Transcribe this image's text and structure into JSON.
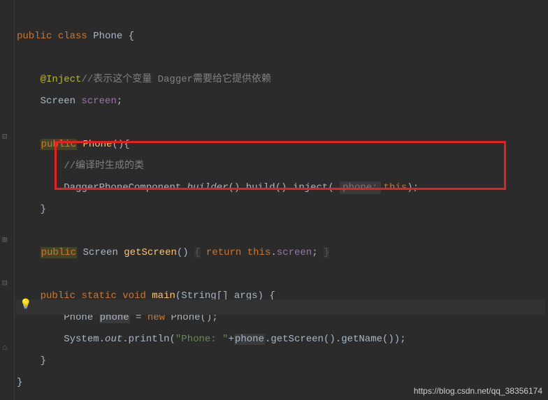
{
  "line1": {
    "public": "public",
    "class": "class",
    "name": "Phone",
    "brace": "{"
  },
  "line3": {
    "anno": "@Inject",
    "comment": "//表示这个变量 Dagger需要给它提供依赖"
  },
  "line4": {
    "type": "Screen",
    "field": "screen",
    "semi": ";"
  },
  "line6": {
    "public": "public",
    "ctor": "Phone",
    "paren": "(){"
  },
  "line7": {
    "comment": "//编译时生成的类"
  },
  "line8": {
    "cls": "DaggerPhoneComponent",
    "dot1": ".",
    "builder": "builder",
    "call1": "().",
    "build": "build",
    "call2": "().",
    "inject": "inject",
    "open": "(",
    "hint": "phone:",
    "this": "this",
    "close": ");"
  },
  "line9": {
    "brace": "}"
  },
  "line11": {
    "public": "public",
    "type": "Screen",
    "name": "getScreen",
    "paren": "()",
    "open": "{",
    "return": "return",
    "this": "this",
    "dot": ".",
    "field": "screen",
    "semi": ";",
    "close": "}"
  },
  "line13": {
    "public": "public",
    "static": "static",
    "void": "void",
    "name": "main",
    "sig": "(String[] args) {"
  },
  "line14": {
    "type": "Phone",
    "var": "phone",
    "eq": " = ",
    "new": "new",
    "ctor": "Phone",
    "end": "();"
  },
  "line15": {
    "sys": "System",
    "dot1": ".",
    "out": "out",
    "dot2": ".",
    "println": "println",
    "open": "(",
    "str": "\"Phone: \"",
    "plus": "+",
    "var": "phone",
    "dot3": ".",
    "getScreen": "getScreen",
    "call1": "().",
    "getName": "getName",
    "end": "());"
  },
  "line16": {
    "brace": "}"
  },
  "line17": {
    "brace": "}"
  },
  "watermark": "https://blog.csdn.net/qq_38356174"
}
